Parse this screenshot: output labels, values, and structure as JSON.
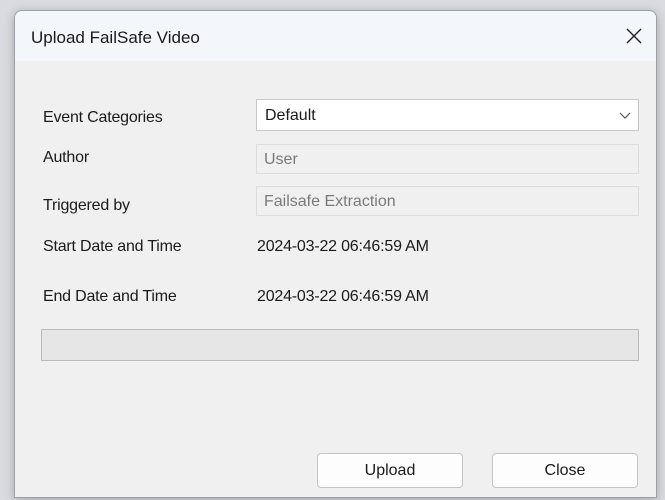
{
  "dialog": {
    "title": "Upload FailSafe Video"
  },
  "form": {
    "event_categories": {
      "label": "Event Categories",
      "value": "Default"
    },
    "author": {
      "label": "Author",
      "value": "User"
    },
    "triggered_by": {
      "label": "Triggered by",
      "value": "Failsafe Extraction"
    },
    "start": {
      "label": "Start Date and Time",
      "value": "2024-03-22 06:46:59 AM"
    },
    "end": {
      "label": "End Date and Time",
      "value": "2024-03-22 06:46:59 AM"
    }
  },
  "progress": {
    "fraction": 0
  },
  "buttons": {
    "upload": "Upload",
    "close": "Close"
  },
  "icons": {
    "close": "close-icon",
    "dropdown": "chevron-down-icon"
  }
}
